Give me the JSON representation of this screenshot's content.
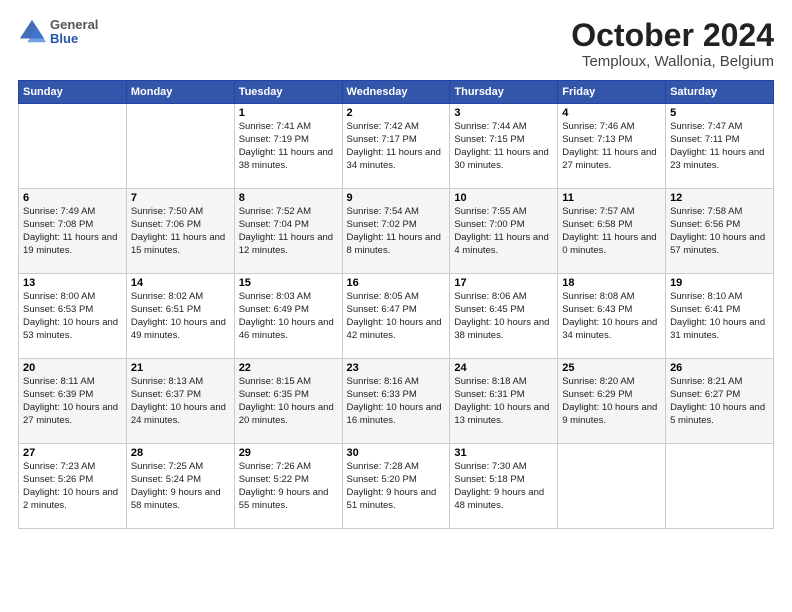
{
  "header": {
    "logo": {
      "general": "General",
      "blue": "Blue"
    },
    "title": "October 2024",
    "subtitle": "Temploux, Wallonia, Belgium"
  },
  "days_of_week": [
    "Sunday",
    "Monday",
    "Tuesday",
    "Wednesday",
    "Thursday",
    "Friday",
    "Saturday"
  ],
  "weeks": [
    [
      {
        "day": "",
        "info": ""
      },
      {
        "day": "",
        "info": ""
      },
      {
        "day": "1",
        "sunrise": "7:41 AM",
        "sunset": "7:19 PM",
        "daylight": "11 hours and 38 minutes."
      },
      {
        "day": "2",
        "sunrise": "7:42 AM",
        "sunset": "7:17 PM",
        "daylight": "11 hours and 34 minutes."
      },
      {
        "day": "3",
        "sunrise": "7:44 AM",
        "sunset": "7:15 PM",
        "daylight": "11 hours and 30 minutes."
      },
      {
        "day": "4",
        "sunrise": "7:46 AM",
        "sunset": "7:13 PM",
        "daylight": "11 hours and 27 minutes."
      },
      {
        "day": "5",
        "sunrise": "7:47 AM",
        "sunset": "7:11 PM",
        "daylight": "11 hours and 23 minutes."
      }
    ],
    [
      {
        "day": "6",
        "sunrise": "7:49 AM",
        "sunset": "7:08 PM",
        "daylight": "11 hours and 19 minutes."
      },
      {
        "day": "7",
        "sunrise": "7:50 AM",
        "sunset": "7:06 PM",
        "daylight": "11 hours and 15 minutes."
      },
      {
        "day": "8",
        "sunrise": "7:52 AM",
        "sunset": "7:04 PM",
        "daylight": "11 hours and 12 minutes."
      },
      {
        "day": "9",
        "sunrise": "7:54 AM",
        "sunset": "7:02 PM",
        "daylight": "11 hours and 8 minutes."
      },
      {
        "day": "10",
        "sunrise": "7:55 AM",
        "sunset": "7:00 PM",
        "daylight": "11 hours and 4 minutes."
      },
      {
        "day": "11",
        "sunrise": "7:57 AM",
        "sunset": "6:58 PM",
        "daylight": "11 hours and 0 minutes."
      },
      {
        "day": "12",
        "sunrise": "7:58 AM",
        "sunset": "6:56 PM",
        "daylight": "10 hours and 57 minutes."
      }
    ],
    [
      {
        "day": "13",
        "sunrise": "8:00 AM",
        "sunset": "6:53 PM",
        "daylight": "10 hours and 53 minutes."
      },
      {
        "day": "14",
        "sunrise": "8:02 AM",
        "sunset": "6:51 PM",
        "daylight": "10 hours and 49 minutes."
      },
      {
        "day": "15",
        "sunrise": "8:03 AM",
        "sunset": "6:49 PM",
        "daylight": "10 hours and 46 minutes."
      },
      {
        "day": "16",
        "sunrise": "8:05 AM",
        "sunset": "6:47 PM",
        "daylight": "10 hours and 42 minutes."
      },
      {
        "day": "17",
        "sunrise": "8:06 AM",
        "sunset": "6:45 PM",
        "daylight": "10 hours and 38 minutes."
      },
      {
        "day": "18",
        "sunrise": "8:08 AM",
        "sunset": "6:43 PM",
        "daylight": "10 hours and 34 minutes."
      },
      {
        "day": "19",
        "sunrise": "8:10 AM",
        "sunset": "6:41 PM",
        "daylight": "10 hours and 31 minutes."
      }
    ],
    [
      {
        "day": "20",
        "sunrise": "8:11 AM",
        "sunset": "6:39 PM",
        "daylight": "10 hours and 27 minutes."
      },
      {
        "day": "21",
        "sunrise": "8:13 AM",
        "sunset": "6:37 PM",
        "daylight": "10 hours and 24 minutes."
      },
      {
        "day": "22",
        "sunrise": "8:15 AM",
        "sunset": "6:35 PM",
        "daylight": "10 hours and 20 minutes."
      },
      {
        "day": "23",
        "sunrise": "8:16 AM",
        "sunset": "6:33 PM",
        "daylight": "10 hours and 16 minutes."
      },
      {
        "day": "24",
        "sunrise": "8:18 AM",
        "sunset": "6:31 PM",
        "daylight": "10 hours and 13 minutes."
      },
      {
        "day": "25",
        "sunrise": "8:20 AM",
        "sunset": "6:29 PM",
        "daylight": "10 hours and 9 minutes."
      },
      {
        "day": "26",
        "sunrise": "8:21 AM",
        "sunset": "6:27 PM",
        "daylight": "10 hours and 5 minutes."
      }
    ],
    [
      {
        "day": "27",
        "sunrise": "7:23 AM",
        "sunset": "5:26 PM",
        "daylight": "10 hours and 2 minutes."
      },
      {
        "day": "28",
        "sunrise": "7:25 AM",
        "sunset": "5:24 PM",
        "daylight": "9 hours and 58 minutes."
      },
      {
        "day": "29",
        "sunrise": "7:26 AM",
        "sunset": "5:22 PM",
        "daylight": "9 hours and 55 minutes."
      },
      {
        "day": "30",
        "sunrise": "7:28 AM",
        "sunset": "5:20 PM",
        "daylight": "9 hours and 51 minutes."
      },
      {
        "day": "31",
        "sunrise": "7:30 AM",
        "sunset": "5:18 PM",
        "daylight": "9 hours and 48 minutes."
      },
      {
        "day": "",
        "info": ""
      },
      {
        "day": "",
        "info": ""
      }
    ]
  ]
}
